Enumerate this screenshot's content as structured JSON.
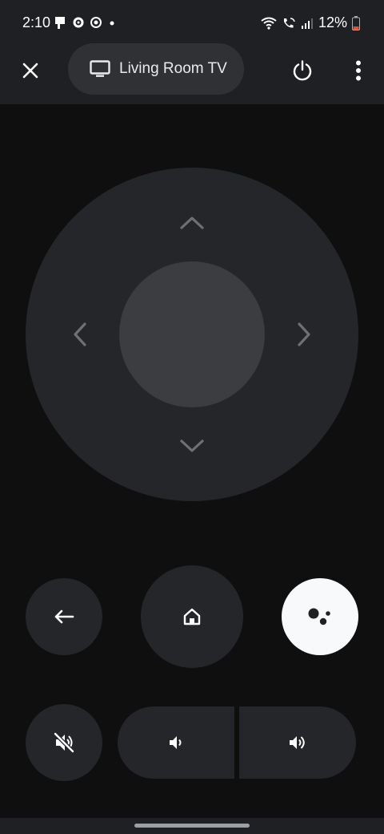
{
  "status_bar": {
    "time": "2:10",
    "battery_percent": "12%",
    "left_icons": [
      "notification-icon",
      "settings-icon",
      "sync-icon",
      "dot-icon"
    ],
    "right_icons": [
      "wifi-icon",
      "wifi-calling-icon",
      "signal-icon",
      "battery-low-icon"
    ]
  },
  "header": {
    "device_name": "Living Room TV",
    "close_icon": "close-icon",
    "device_icon": "tv-icon",
    "power_icon": "power-icon",
    "more_icon": "more-vert-icon"
  },
  "dpad": {
    "up_icon": "chevron-up-icon",
    "down_icon": "chevron-down-icon",
    "left_icon": "chevron-left-icon",
    "right_icon": "chevron-right-icon"
  },
  "controls": {
    "back_icon": "arrow-back-icon",
    "home_icon": "home-icon",
    "assistant_icon": "google-assistant-icon",
    "mute_icon": "volume-off-icon",
    "volume_down_icon": "volume-down-icon",
    "volume_up_icon": "volume-up-icon"
  },
  "colors": {
    "background": "#0f0f0f",
    "bar": "#1f2023",
    "surface": "#25262a",
    "center": "#3c3d41",
    "chip": "#303134",
    "assistant_bg": "#f8f9fa"
  }
}
